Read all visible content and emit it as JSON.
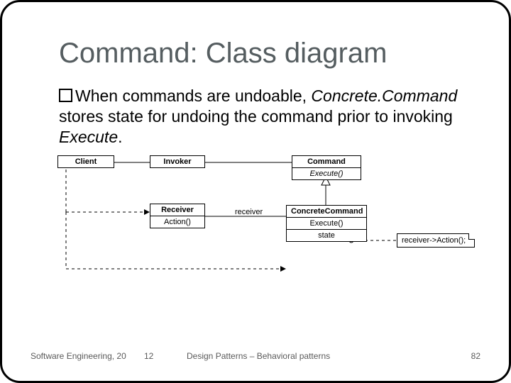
{
  "title": "Command: Class diagram",
  "bullet": {
    "prefix": "When commands are undoable, ",
    "italic1": "Concrete.Command",
    "mid": " stores state for undoing the command prior to invoking ",
    "italic2": "Execute",
    "suffix": "."
  },
  "classes": {
    "client": {
      "name": "Client"
    },
    "invoker": {
      "name": "Invoker"
    },
    "command": {
      "name": "Command",
      "op": "Execute()"
    },
    "receiver": {
      "name": "Receiver",
      "op": "Action()"
    },
    "concrete": {
      "name": "ConcreteCommand",
      "op": "Execute()",
      "attr": "state"
    }
  },
  "labels": {
    "receiver_assoc": "receiver"
  },
  "note": "receiver->Action();",
  "footer": {
    "left": "Software Engineering, 20",
    "mid1": "12",
    "mid2": "Design Patterns – Behavioral patterns",
    "right": "82"
  }
}
